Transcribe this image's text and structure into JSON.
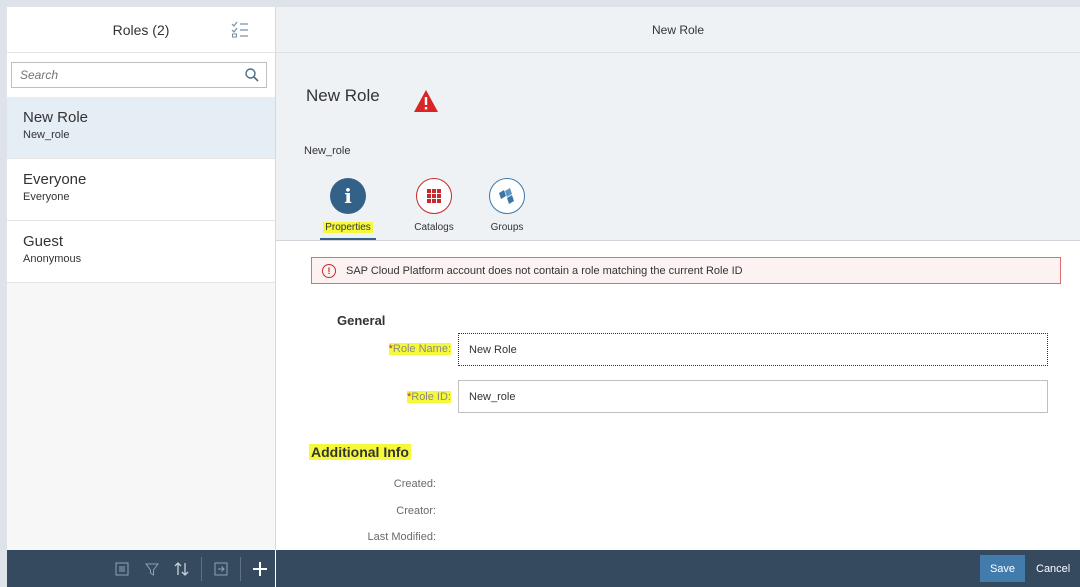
{
  "master": {
    "title": "Roles (2)",
    "search_placeholder": "Search",
    "items": [
      {
        "title": "New Role",
        "subtitle": "New_role"
      },
      {
        "title": "Everyone",
        "subtitle": "Everyone"
      },
      {
        "title": "Guest",
        "subtitle": "Anonymous"
      }
    ]
  },
  "detail": {
    "header_title": "New Role",
    "object_title": "New Role",
    "object_subtitle": "New_role",
    "tabs": [
      {
        "label": "Properties",
        "icon": "info-icon"
      },
      {
        "label": "Catalogs",
        "icon": "grid-icon"
      },
      {
        "label": "Groups",
        "icon": "groups-icon"
      }
    ],
    "message": "SAP Cloud Platform account does not contain a role matching the current Role ID",
    "general": {
      "title": "General",
      "role_name_label": "Role Name:",
      "role_name_value": "New Role",
      "role_id_label": "Role ID:",
      "role_id_value": "New_role",
      "required_marker": "*"
    },
    "additional": {
      "title": "Additional Info",
      "created_label": "Created:",
      "creator_label": "Creator:",
      "last_modified_label": "Last Modified:"
    }
  },
  "footer": {
    "save_label": "Save",
    "cancel_label": "Cancel"
  },
  "colors": {
    "shell_dark": "#354a5f",
    "accent": "#346187",
    "error": "#c62a2a",
    "highlight": "#f6f93a"
  }
}
